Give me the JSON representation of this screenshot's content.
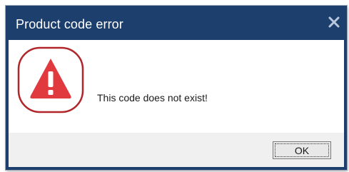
{
  "dialog": {
    "title": "Product code error",
    "message": "This code does not exist!",
    "ok_label": "OK",
    "icons": {
      "close": "close-icon",
      "status": "warning-triangle-icon"
    }
  },
  "colors": {
    "titlebar": "#1c3f6e",
    "warning": "#e0393e",
    "highlight_ring": "#b0262b",
    "footer": "#f0f0f0"
  }
}
